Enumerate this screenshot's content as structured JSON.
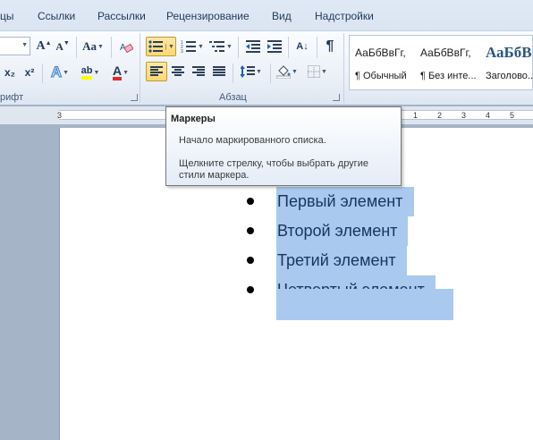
{
  "menu_tabs": [
    "цы",
    "Ссылки",
    "Рассылки",
    "Рецензирование",
    "Вид",
    "Надстройки"
  ],
  "ribbon": {
    "font_group_label": "Шрифт",
    "font_group_label_visible": "рифт",
    "paragraph_group_label": "Абзац",
    "grow_font": "A",
    "shrink_font": "A",
    "change_case": "Aa",
    "subscript": "x₂",
    "superscript": "x²",
    "text_effects": "A",
    "highlight": "ab",
    "font_color": "A",
    "show_marks": "¶",
    "sort": "A↓",
    "accent_colors": {
      "highlight": "#ffff00",
      "font_color": "#e02a2a",
      "active_button": "#fbd873"
    }
  },
  "styles_gallery": [
    {
      "sample": "АаБбВвГг,",
      "name": "¶ Обычный"
    },
    {
      "sample": "АаБбВвГг,",
      "name": "¶ Без инте..."
    },
    {
      "sample": "АаБбВ",
      "name": "Заголово..."
    }
  ],
  "ruler": {
    "numbers": [
      "3",
      "1",
      "2",
      "3",
      "4",
      "5",
      "6"
    ]
  },
  "tooltip": {
    "title": "Маркеры",
    "line1": "Начало маркированного списка.",
    "line2": "Щелкните стрелку, чтобы выбрать другие",
    "line3": "стили маркера."
  },
  "document": {
    "list_items": [
      "Первый элемент",
      "Второй элемент",
      "Третий элемент",
      "Четвертый элемент"
    ]
  }
}
